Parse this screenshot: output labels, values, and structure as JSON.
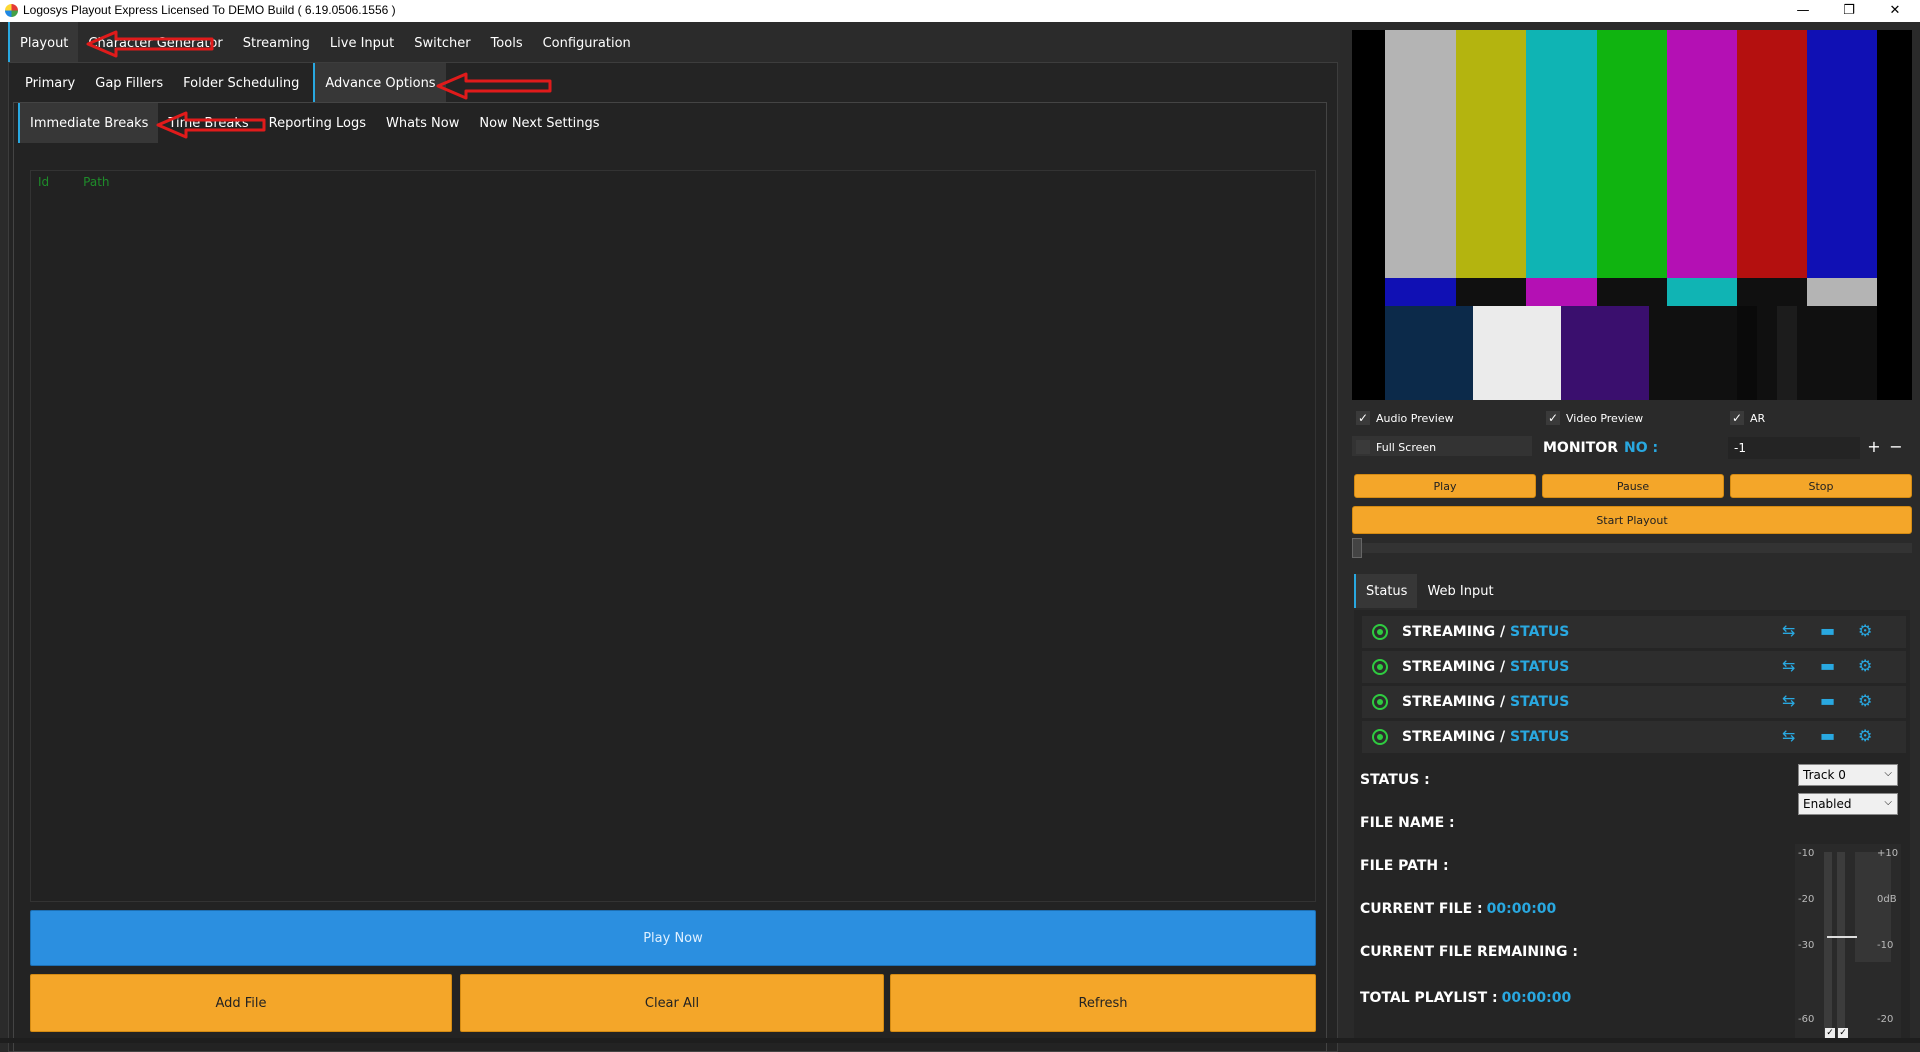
{
  "window": {
    "title": "Logosys Playout Express Licensed To DEMO Build ( 6.19.0506.1556 )",
    "minimize": "—",
    "restore": "❐",
    "close": "✕"
  },
  "main_tabs": [
    "Playout",
    "Character Generator",
    "Streaming",
    "Live Input",
    "Switcher",
    "Tools",
    "Configuration"
  ],
  "sub_tabs": [
    "Primary",
    "Gap Fillers",
    "Folder Scheduling",
    "Advance Options"
  ],
  "inner_tabs": [
    "Immediate Breaks",
    "Time Breaks",
    "Reporting Logs",
    "Whats Now",
    "Now Next Settings"
  ],
  "list": {
    "col_id": "Id",
    "col_path": "Path"
  },
  "buttons": {
    "play_now": "Play Now",
    "add_file": "Add File",
    "clear_all": "Clear All",
    "refresh": "Refresh"
  },
  "preview": {
    "audio_preview": "Audio Preview",
    "video_preview": "Video Preview",
    "ar": "AR",
    "full_screen": "Full Screen",
    "monitor_label": "MONITOR",
    "monitor_no": "NO :",
    "monitor_value": "-1",
    "play": "Play",
    "pause": "Pause",
    "stop": "Stop",
    "start_playout": "Start Playout"
  },
  "status_tabs": [
    "Status",
    "Web Input"
  ],
  "streams": [
    {
      "prefix": "STREAMING /",
      "status": "STATUS"
    },
    {
      "prefix": "STREAMING /",
      "status": "STATUS"
    },
    {
      "prefix": "STREAMING /",
      "status": "STATUS"
    },
    {
      "prefix": "STREAMING /",
      "status": "STATUS"
    }
  ],
  "info": {
    "status": "STATUS :",
    "file_name": "FILE NAME :",
    "file_path": "FILE PATH :",
    "current_file": "CURRENT FILE :",
    "current_file_value": "00:00:00",
    "current_remaining": "CURRENT FILE REMAINING :",
    "total_playlist": "TOTAL PLAYLIST :",
    "total_playlist_value": "00:00:00"
  },
  "selects": {
    "track": "Track 0",
    "enabled": "Enabled"
  },
  "meter_labels": {
    "l1": "-10",
    "r1": "+10",
    "l2": "-20",
    "r2": "0dB",
    "l3": "-30",
    "r3": "-10",
    "l4": "-60",
    "r4": "-20"
  },
  "colors": {
    "accent": "#29a8e0",
    "orange": "#f4a629",
    "blue_button": "#2b8fe0",
    "green": "#2ecc40"
  }
}
